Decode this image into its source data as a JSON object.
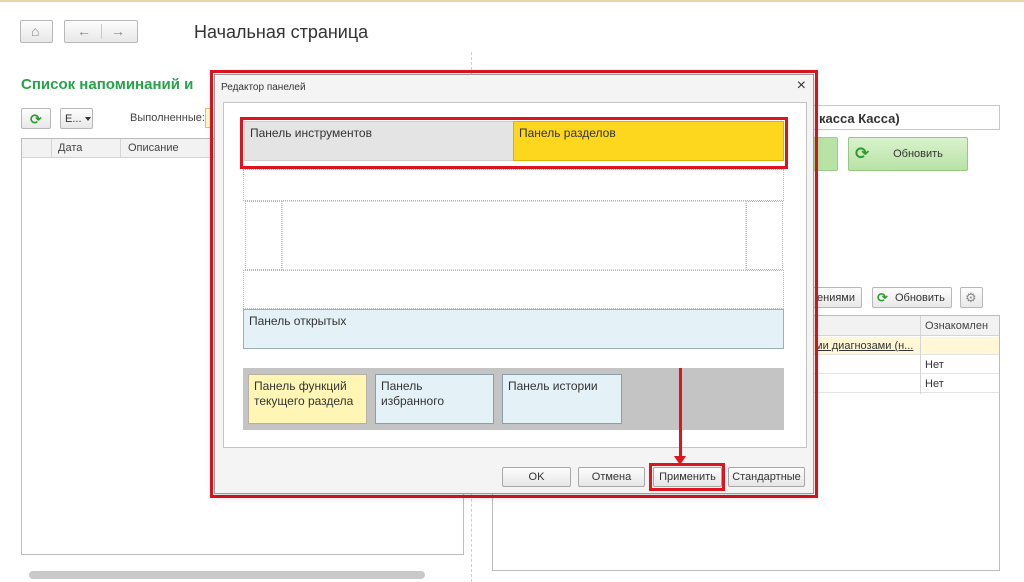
{
  "page": {
    "title": "Начальная страница",
    "section_title": "Список напоминаний и",
    "nav": {
      "home_icon": "home-icon",
      "back_icon": "arrow-left-icon",
      "forward_icon": "arrow-right-icon"
    }
  },
  "left_panel": {
    "combo_value": "Е...",
    "done_label": "Выполненные:",
    "columns": [
      "Дата",
      "Описание"
    ]
  },
  "right_panel": {
    "field_value": "касса Касса)",
    "refresh_label": "Обновить",
    "toolbar_partial_label": "ениями",
    "toolbar_refresh_label": "Обновить",
    "columns": [
      "Ознакомлен"
    ],
    "rows": [
      {
        "text": "ми диагнозами (н...",
        "value": ""
      },
      {
        "text": "",
        "value": "Нет"
      },
      {
        "text": "",
        "value": "Нет"
      }
    ]
  },
  "dialog": {
    "title": "Редактор панелей",
    "close_label": "×",
    "panels": {
      "tools": "Панель инструментов",
      "sections": "Панель разделов",
      "open": "Панель открытых",
      "functions": "Панель функций текущего раздела",
      "favorites": "Панель избранного",
      "history": "Панель истории"
    },
    "buttons": {
      "ok": "OK",
      "cancel": "Отмена",
      "apply": "Применить",
      "standard": "Стандартные"
    }
  },
  "colors": {
    "accent_green": "#27a34a",
    "highlight_red": "#e0141e",
    "sections_yellow": "#fcd71d"
  }
}
